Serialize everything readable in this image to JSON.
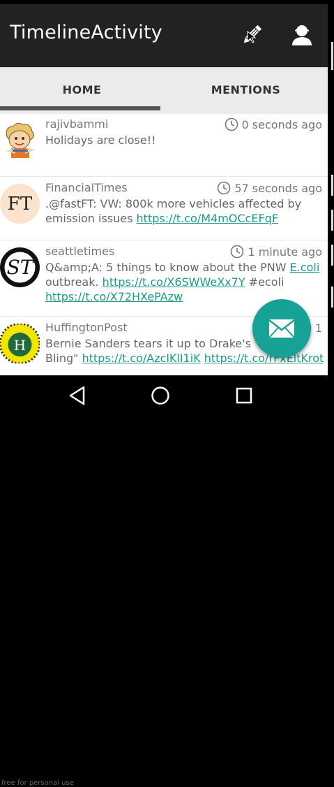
{
  "app_title": "TimelineActivity",
  "actions": [
    {
      "name": "compose",
      "icon": "pencil-icon"
    },
    {
      "name": "profile",
      "icon": "person-icon"
    }
  ],
  "tabs": [
    {
      "label": "HOME",
      "selected": true
    },
    {
      "label": "MENTIONS",
      "selected": false
    }
  ],
  "tweets": [
    {
      "user": "rajivbammi",
      "time": "0 seconds ago",
      "text_before": "Holidays are close!!",
      "link": "",
      "text_after": "",
      "link2": "",
      "text_after2": "",
      "link3": ""
    },
    {
      "user": "FinancialTimes",
      "time": "57 seconds ago",
      "text_before": ".@fastFT: VW: 800k more vehicles affected by emission issues ",
      "link": "https://t.co/M4mOCcEFqF",
      "text_after": "",
      "link2": "",
      "text_after2": "",
      "link3": ""
    },
    {
      "user": "seattletimes",
      "time": "1 minute ago",
      "text_before": "Q&amp;A: 5 things to know about the PNW ",
      "link": "E.coli",
      "text_after": " outbreak. ",
      "link2": "https://t.co/X6SWWeXx7Y",
      "text_after2": " #ecoli ",
      "link3": "https://t.co/X72HXePAzw"
    },
    {
      "user": "HuffingtonPost",
      "time": "1",
      "text_before": "Bernie Sanders tears it up to Drake's \"Hotline Bling\" ",
      "link": "https://t.co/AzclKlI1iK",
      "text_after": " ",
      "link2": "https://t.co/rFxEltKrot",
      "text_after2": "",
      "link3": ""
    }
  ],
  "watermark": "free for personal use",
  "colors": {
    "appbar": "#222222",
    "accent": "#16a395",
    "link": "#1a9a8a",
    "tab_bg": "#ebebeb"
  }
}
